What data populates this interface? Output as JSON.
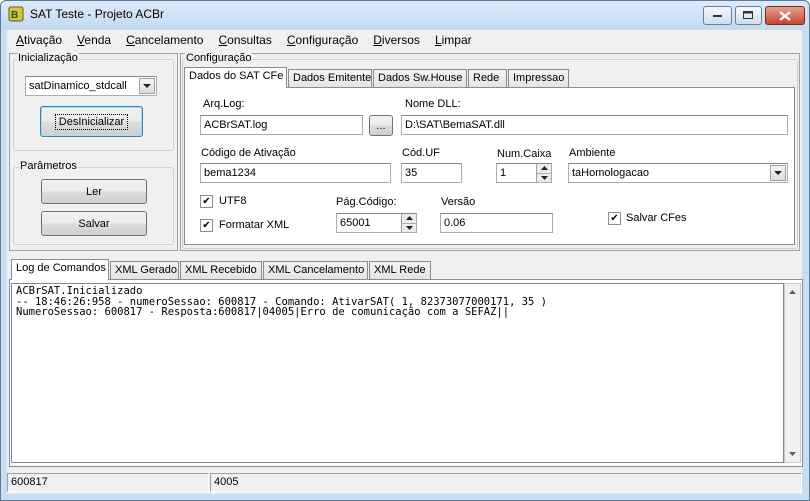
{
  "window": {
    "title": "SAT Teste - Projeto ACBr"
  },
  "menu": [
    "Ativação",
    "Venda",
    "Cancelamento",
    "Consultas",
    "Configuração",
    "Diversos",
    "Limpar"
  ],
  "inicializacao": {
    "group_title": "Inicialização",
    "model_select": "satDinamico_stdcall",
    "desinicializar_label": "DesInicializar"
  },
  "parametros": {
    "group_title": "Parâmetros",
    "ler_label": "Ler",
    "salvar_label": "Salvar"
  },
  "configuracao": {
    "group_title": "Configuração",
    "tabs": [
      "Dados do SAT CFe",
      "Dados Emitente",
      "Dados Sw.House",
      "Rede",
      "Impressao"
    ],
    "arq_log_label": "Arq.Log:",
    "arq_log_value": "ACBrSAT.log",
    "browse_label": "...",
    "nome_dll_label": "Nome DLL:",
    "nome_dll_value": "D:\\SAT\\BemaSAT.dll",
    "codigo_ativacao_label": "Código de Ativação",
    "codigo_ativacao_value": "bema1234",
    "cod_uf_label": "Cód.UF",
    "cod_uf_value": "35",
    "num_caixa_label": "Num.Caixa",
    "num_caixa_value": "1",
    "ambiente_label": "Ambiente",
    "ambiente_value": "taHomologacao",
    "utf8_label": "UTF8",
    "utf8_checked": true,
    "formatar_xml_label": "Formatar XML",
    "formatar_xml_checked": true,
    "pag_codigo_label": "Pág.Código:",
    "pag_codigo_value": "65001",
    "versao_label": "Versão",
    "versao_value": "0.06",
    "salvar_cfes_label": "Salvar CFes",
    "salvar_cfes_checked": true
  },
  "bottom_tabs": [
    "Log de Comandos",
    "XML Gerado",
    "XML Recebido",
    "XML Cancelamento",
    "XML Rede"
  ],
  "log_lines": [
    "ACBrSAT.Inicializado",
    "-- 18:46:26:958 - numeroSessao: 600817 - Comando: AtivarSAT( 1, 82373077000171, 35 )",
    "NumeroSessao: 600817 - Resposta:600817|04005|Erro de comunicação com a SEFAZ||"
  ],
  "status": {
    "sessao": "600817",
    "codigo": "4005"
  }
}
